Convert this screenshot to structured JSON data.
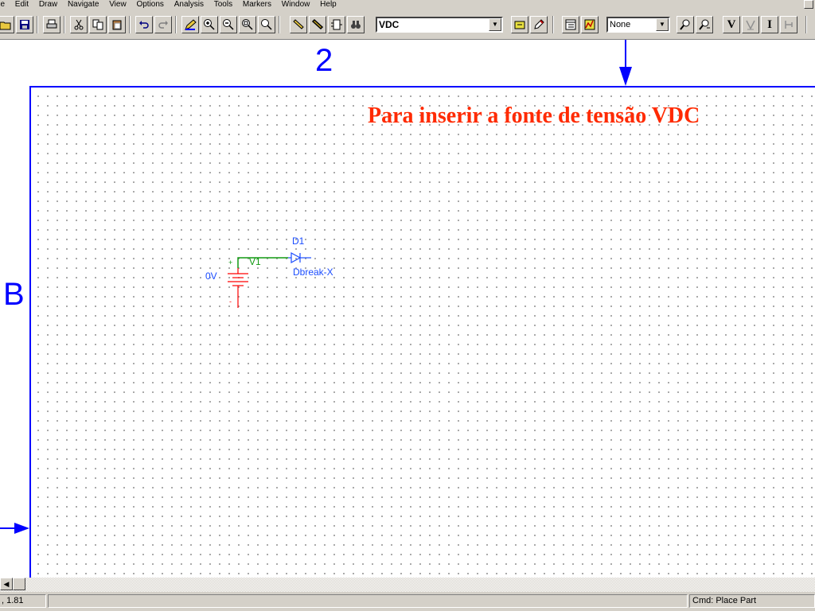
{
  "menu": [
    "ile",
    "Edit",
    "Draw",
    "Navigate",
    "View",
    "Options",
    "Analysis",
    "Tools",
    "Markers",
    "Window",
    "Help"
  ],
  "toolbar": {
    "part_combo_value": "VDC",
    "display_combo_value": "None",
    "v_marker_label": "V",
    "i_marker_label": "I"
  },
  "sheet": {
    "zone_column": "2",
    "zone_row": "B"
  },
  "annotation": "Para inserir a fonte de tensão VDC",
  "schematic": {
    "diode_ref": "D1",
    "diode_model": "Dbreak-X",
    "source_ref": "V1",
    "source_value": "0V",
    "plus_sign": "+",
    "minus_sign": "-"
  },
  "status": {
    "coords": ", 1.81",
    "command": "Cmd: Place Part"
  },
  "colors": {
    "annotation": "#ff2a00",
    "border": "#0000ff",
    "wire": "#129a12",
    "part": "#ff0000",
    "label": "#1a4cff"
  }
}
